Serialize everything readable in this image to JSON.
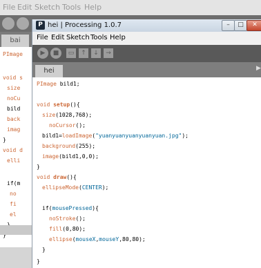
{
  "background_window": {
    "menu": [
      "File",
      "Edit",
      "Sketch",
      "Tools",
      "Help"
    ],
    "tab": "bai",
    "code_lines": [
      "PImage",
      "void s",
      "size",
      "noCu",
      "bild",
      "back",
      "imag",
      "}",
      "void d",
      "elli",
      "if(m",
      "no",
      "fi",
      "el",
      "}",
      "}"
    ]
  },
  "window": {
    "title": "hei | Processing 1.0.7",
    "app_icon": "P",
    "controls": [
      "minimize",
      "maximize",
      "close"
    ]
  },
  "menu": [
    "File",
    "Edit",
    "Sketch",
    "Tools",
    "Help"
  ],
  "toolbar": [
    "run-icon",
    "stop-icon",
    "new-icon",
    "open-icon",
    "save-icon",
    "export-icon"
  ],
  "tab": "hei",
  "code": [
    "PImage bild1;",
    "",
    "void setup(){",
    "  size(1028,768);",
    "    noCursor();",
    "  bild1=loadImage(\"yuanyuanyuanyuanyuan.jpg\");",
    "  background(255);",
    "  image(bild1,0,0);",
    "}",
    "void draw(){",
    "  ellipseMode(CENTER);",
    "",
    "  if(mousePressed){",
    "    noStroke();",
    "    fill(0,80);",
    "    ellipse(mouseX,mouseY,80,80);",
    "  }",
    "}"
  ],
  "colors": {
    "keyword": "#cc6633",
    "constant": "#006699",
    "toolbar": "#595959"
  }
}
